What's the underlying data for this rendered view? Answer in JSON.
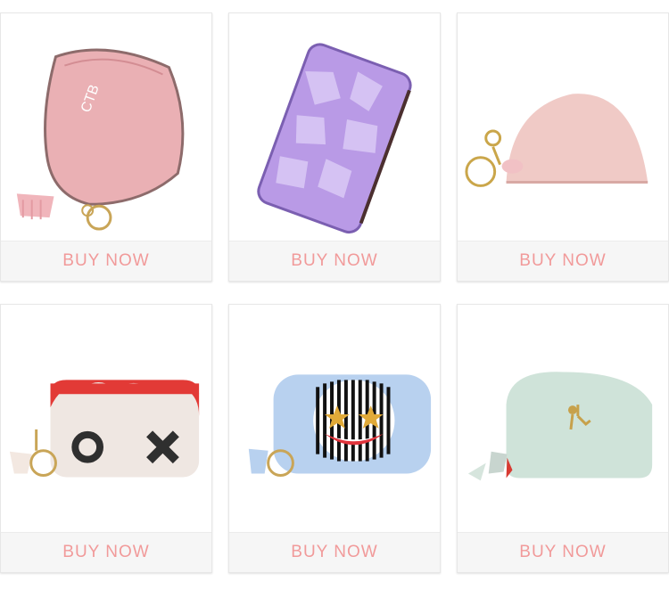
{
  "products": [
    {
      "name": "pink semicircle zip coin purse",
      "cta": "BUY NOW",
      "color": "#e8a6ad"
    },
    {
      "name": "lavender geometric card wallet",
      "cta": "BUY NOW",
      "color": "#b99ae6"
    },
    {
      "name": "nude pink shell coin pouch",
      "cta": "BUY NOW",
      "color": "#f0cac6"
    },
    {
      "name": "red hair face coin purse",
      "cta": "BUY NOW",
      "color": "#e23a36"
    },
    {
      "name": "light blue smiley coin purse",
      "cta": "BUY NOW",
      "color": "#b8d1ef"
    },
    {
      "name": "mint flamingo coin purse",
      "cta": "BUY NOW",
      "color": "#cfe3d9"
    }
  ],
  "colors": {
    "button_text": "#f19a9a",
    "button_bg": "#f6f6f6"
  }
}
